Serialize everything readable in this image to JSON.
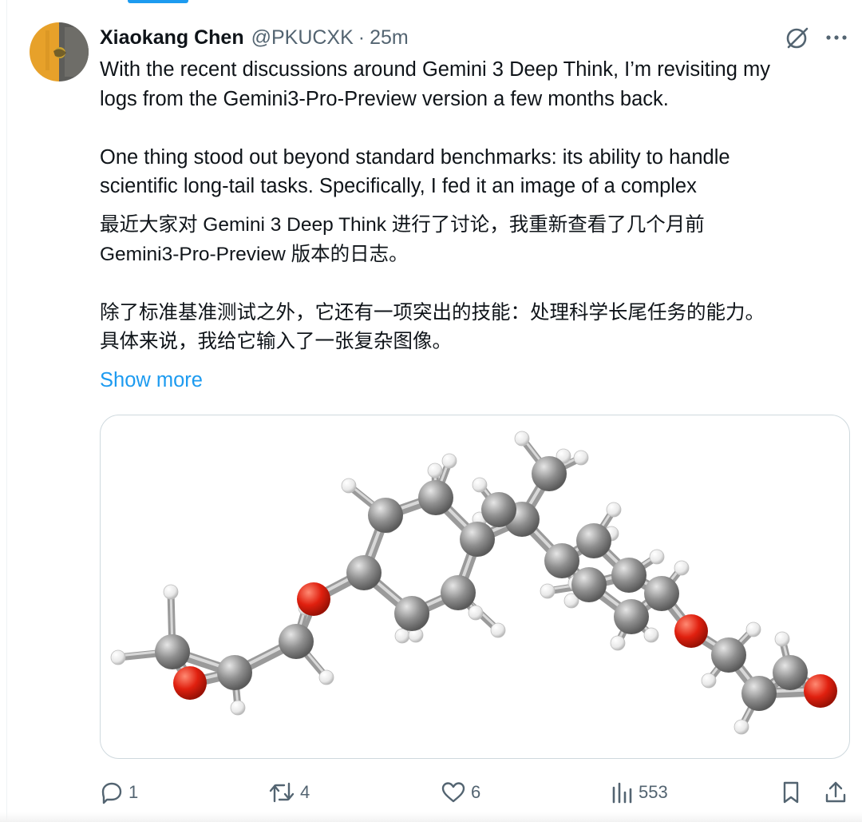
{
  "author": {
    "display_name": "Xiaokang Chen",
    "handle": "@PKUCXK",
    "separator": "·",
    "time": "25m",
    "avatar_icon": "avatar-photo"
  },
  "post": {
    "text_en_lines": [
      "With the recent discussions around Gemini 3 Deep Think, I’m revisiting my",
      "logs from the Gemini3-Pro-Preview version a few months back.",
      "",
      "One thing stood out beyond standard benchmarks: its ability to handle",
      "scientific long-tail tasks. Specifically, I fed it an image of a complex"
    ],
    "text_zh_lines": [
      "最近大家对 Gemini 3 Deep Think 进行了讨论，我重新查看了几个月前",
      "Gemini3-Pro-Preview 版本的日志。",
      "",
      "除了标准基准测试之外，它还有一项突出的技能：处理科学长尾任务的能力。",
      "具体来说，我给它输入了一张复杂图像。"
    ],
    "show_more": "Show more"
  },
  "media": {
    "description_icon": "molecule-ball-and-stick-image",
    "colors": {
      "carbon": "#8c8c8c",
      "hydrogen": "#f2f2f2",
      "oxygen": "#e0200f",
      "bond": "#a9a9a9"
    }
  },
  "actions": {
    "reply": {
      "icon": "reply-icon",
      "count": "1"
    },
    "repost": {
      "icon": "repost-icon",
      "count": "4"
    },
    "like": {
      "icon": "heart-icon",
      "count": "6"
    },
    "views": {
      "icon": "views-icon",
      "count": "553"
    },
    "bookmark": {
      "icon": "bookmark-icon"
    },
    "share": {
      "icon": "share-icon"
    }
  },
  "colors": {
    "accent": "#1d9bf0",
    "text": "#0f1419",
    "muted": "#536471",
    "border": "#cfd9de"
  }
}
